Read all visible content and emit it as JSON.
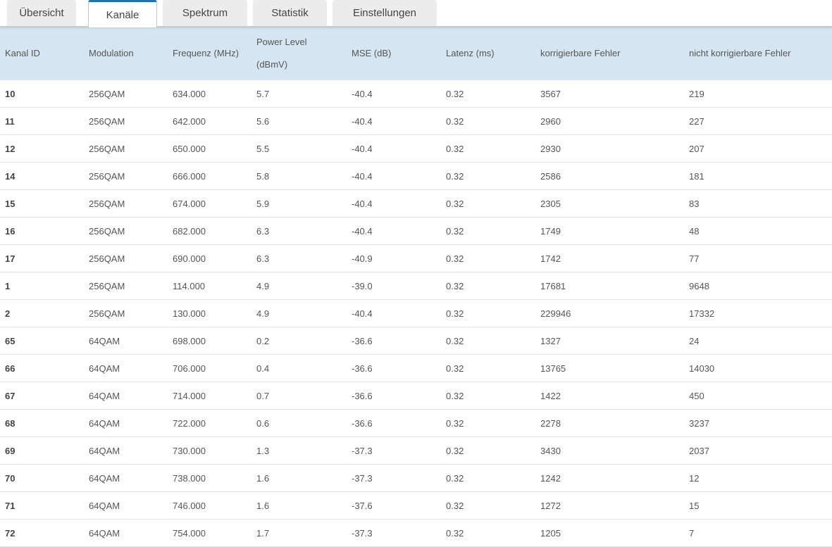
{
  "tabs": [
    {
      "label": "Übersicht",
      "active": false
    },
    {
      "label": "Kanäle",
      "active": true
    },
    {
      "label": "Spektrum",
      "active": false
    },
    {
      "label": "Statistik",
      "active": false
    },
    {
      "label": "Einstellungen",
      "active": false
    }
  ],
  "table": {
    "headers": [
      "Kanal ID",
      "Modulation",
      "Frequenz (MHz)",
      "Power Level",
      "MSE (dB)",
      "Latenz (ms)",
      "korrigierbare Fehler",
      "nicht korrigierbare Fehler"
    ],
    "header_power_unit": "(dBmV)",
    "rows": [
      [
        "10",
        "256QAM",
        "634.000",
        "5.7",
        "-40.4",
        "0.32",
        "3567",
        "219"
      ],
      [
        "11",
        "256QAM",
        "642.000",
        "5.6",
        "-40.4",
        "0.32",
        "2960",
        "227"
      ],
      [
        "12",
        "256QAM",
        "650.000",
        "5.5",
        "-40.4",
        "0.32",
        "2930",
        "207"
      ],
      [
        "14",
        "256QAM",
        "666.000",
        "5.8",
        "-40.4",
        "0.32",
        "2586",
        "181"
      ],
      [
        "15",
        "256QAM",
        "674.000",
        "5.9",
        "-40.4",
        "0.32",
        "2305",
        "83"
      ],
      [
        "16",
        "256QAM",
        "682.000",
        "6.3",
        "-40.4",
        "0.32",
        "1749",
        "48"
      ],
      [
        "17",
        "256QAM",
        "690.000",
        "6.3",
        "-40.9",
        "0.32",
        "1742",
        "77"
      ],
      [
        "1",
        "256QAM",
        "114.000",
        "4.9",
        "-39.0",
        "0.32",
        "17681",
        "9648"
      ],
      [
        "2",
        "256QAM",
        "130.000",
        "4.9",
        "-40.4",
        "0.32",
        "229946",
        "17332"
      ],
      [
        "65",
        "64QAM",
        "698.000",
        "0.2",
        "-36.6",
        "0.32",
        "1327",
        "24"
      ],
      [
        "66",
        "64QAM",
        "706.000",
        "0.4",
        "-36.6",
        "0.32",
        "13765",
        "14030"
      ],
      [
        "67",
        "64QAM",
        "714.000",
        "0.7",
        "-36.6",
        "0.32",
        "1422",
        "450"
      ],
      [
        "68",
        "64QAM",
        "722.000",
        "0.6",
        "-36.6",
        "0.32",
        "2278",
        "3237"
      ],
      [
        "69",
        "64QAM",
        "730.000",
        "1.3",
        "-37.3",
        "0.32",
        "3430",
        "2037"
      ],
      [
        "70",
        "64QAM",
        "738.000",
        "1.6",
        "-37.3",
        "0.32",
        "1242",
        "12"
      ],
      [
        "71",
        "64QAM",
        "746.000",
        "1.6",
        "-37.6",
        "0.32",
        "1272",
        "15"
      ],
      [
        "72",
        "64QAM",
        "754.000",
        "1.7",
        "-37.3",
        "0.32",
        "1205",
        "7"
      ]
    ]
  }
}
